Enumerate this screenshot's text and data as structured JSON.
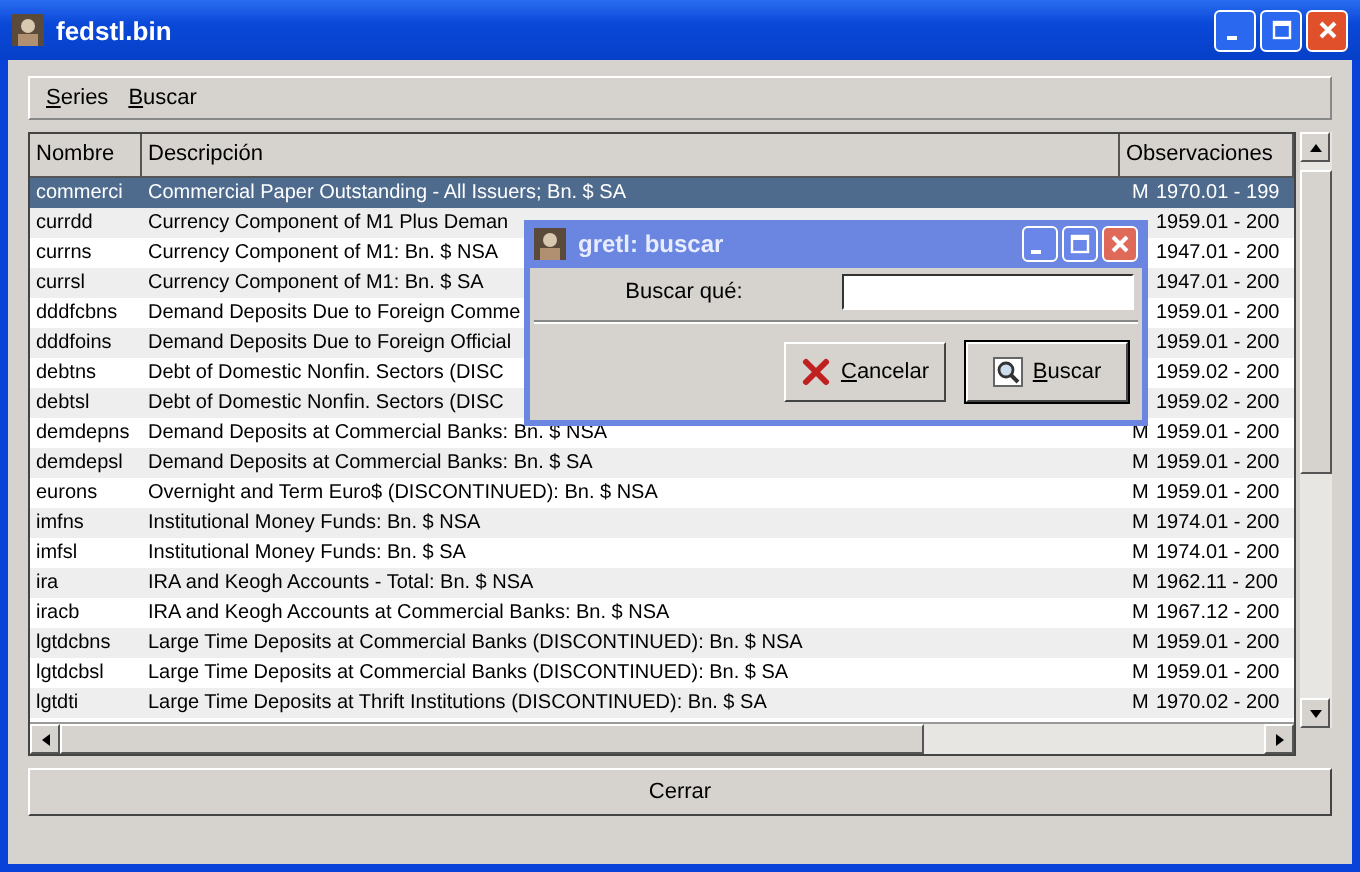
{
  "window": {
    "title": "fedstl.bin"
  },
  "menu": [
    {
      "label": "Series"
    },
    {
      "label": "Buscar"
    }
  ],
  "table": {
    "columns": [
      "Nombre",
      "Descripción",
      "Observaciones"
    ],
    "rows": [
      {
        "name": "commerci",
        "description": "Commercial Paper Outstanding - All Issuers; Bn. $ SA",
        "freq": "M",
        "range": "1970.01 - 199",
        "selected": true
      },
      {
        "name": "currdd",
        "description": "Currency Component of M1 Plus Deman",
        "range": "1959.01 - 200",
        "selected": false
      },
      {
        "name": "currns",
        "description": "Currency Component of M1: Bn. $ NSA",
        "range": "1947.01 - 200",
        "selected": false
      },
      {
        "name": "currsl",
        "description": "Currency Component of M1: Bn. $ SA",
        "range": "1947.01 - 200",
        "selected": false
      },
      {
        "name": "dddfcbns",
        "description": "Demand Deposits Due to Foreign Comme",
        "range": "1959.01 - 200",
        "selected": false
      },
      {
        "name": "dddfoins",
        "description": "Demand Deposits Due to Foreign Official",
        "range": "1959.01 - 200",
        "selected": false
      },
      {
        "name": "debtns",
        "description": "Debt of Domestic Nonfin. Sectors (DISC",
        "range": "1959.02 - 200",
        "selected": false
      },
      {
        "name": "debtsl",
        "description": "Debt of Domestic Nonfin. Sectors (DISC",
        "range": "1959.02 - 200",
        "selected": false
      },
      {
        "name": "demdepns",
        "description": "Demand Deposits at Commercial Banks: Bn. $ NSA",
        "freq": "M",
        "range": "1959.01 - 200",
        "selected": false
      },
      {
        "name": "demdepsl",
        "description": "Demand Deposits at Commercial Banks: Bn. $ SA",
        "freq": "M",
        "range": "1959.01 - 200",
        "selected": false
      },
      {
        "name": "eurons",
        "description": "Overnight and Term Euro$ (DISCONTINUED): Bn. $ NSA",
        "freq": "M",
        "range": "1959.01 - 200",
        "selected": false
      },
      {
        "name": "imfns",
        "description": "Institutional Money Funds: Bn. $ NSA",
        "freq": "M",
        "range": "1974.01 - 200",
        "selected": false
      },
      {
        "name": "imfsl",
        "description": "Institutional Money Funds: Bn. $ SA",
        "freq": "M",
        "range": "1974.01 - 200",
        "selected": false
      },
      {
        "name": "ira",
        "description": "IRA and Keogh Accounts - Total: Bn. $ NSA",
        "freq": "M",
        "range": "1962.11 - 200",
        "selected": false
      },
      {
        "name": "iracb",
        "description": "IRA and Keogh Accounts at Commercial Banks: Bn. $ NSA",
        "freq": "M",
        "range": "1967.12 - 200",
        "selected": false
      },
      {
        "name": "lgtdcbns",
        "description": "Large Time Deposits at Commercial Banks (DISCONTINUED): Bn. $ NSA",
        "freq": "M",
        "range": "1959.01 - 200",
        "selected": false
      },
      {
        "name": "lgtdcbsl",
        "description": "Large Time Deposits at Commercial Banks (DISCONTINUED): Bn. $ SA",
        "freq": "M",
        "range": "1959.01 - 200",
        "selected": false
      },
      {
        "name": "lgtdti",
        "description": "Large Time Deposits at Thrift Institutions (DISCONTINUED): Bn. $ SA",
        "freq": "M",
        "range": "1970.02 - 200",
        "selected": false
      }
    ]
  },
  "close_button": "Cerrar",
  "dialog": {
    "title": "gretl: buscar",
    "label": "Buscar qué:",
    "buttons": [
      {
        "label": "Cancelar",
        "kind": "cancel"
      },
      {
        "label": "Buscar",
        "kind": "search"
      }
    ]
  }
}
